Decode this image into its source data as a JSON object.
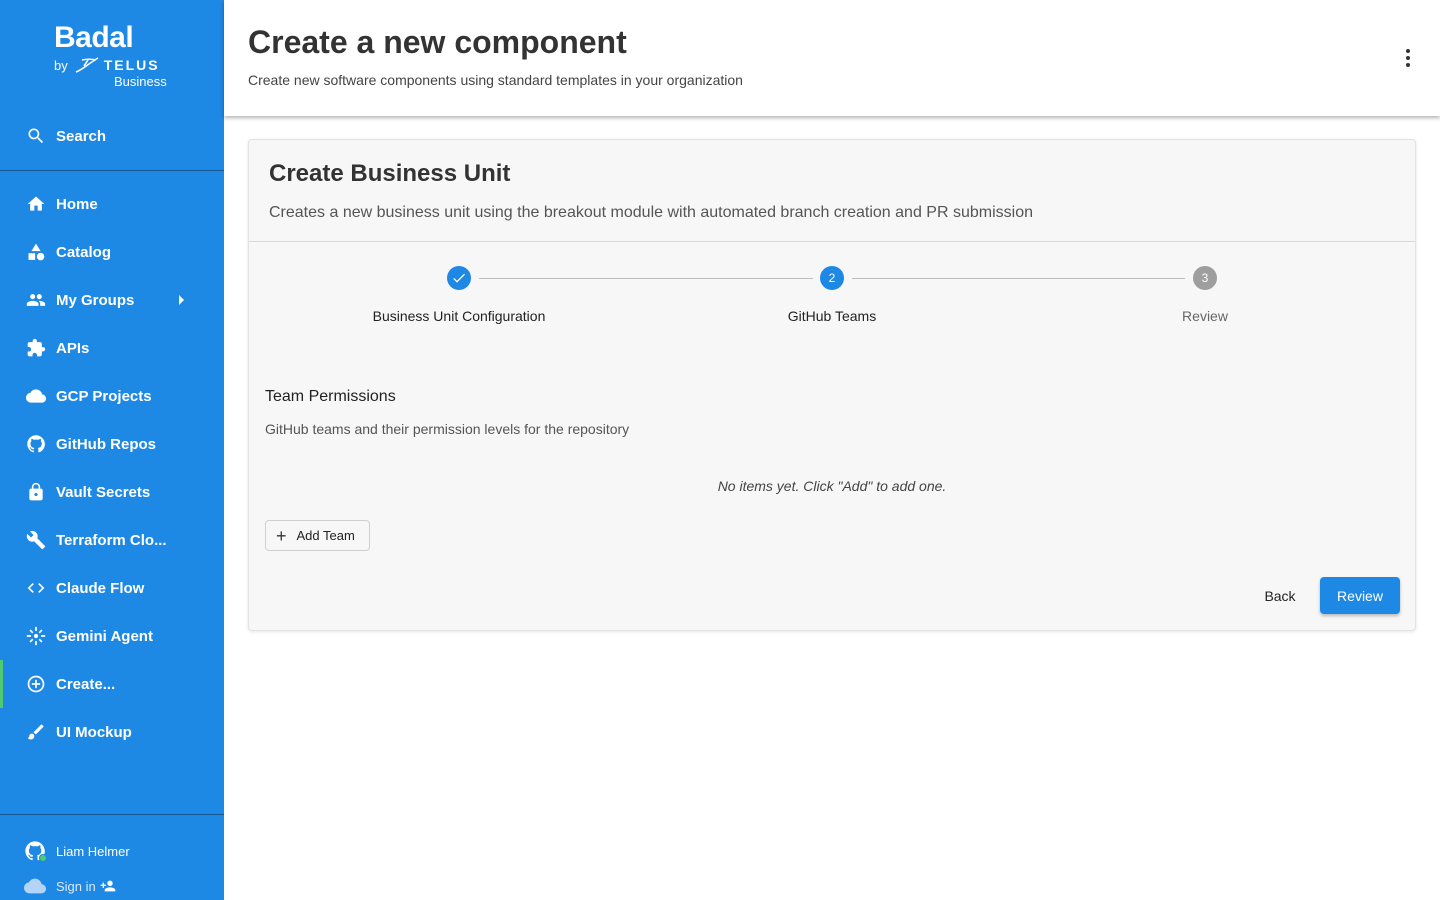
{
  "sidebar": {
    "logo": {
      "brand": "Badal",
      "by": "by",
      "telus": "TELUS",
      "business": "Business"
    },
    "search_label": "Search",
    "items": [
      {
        "label": "Home",
        "icon": "home-icon"
      },
      {
        "label": "Catalog",
        "icon": "category-icon"
      },
      {
        "label": "My Groups",
        "icon": "group-icon"
      },
      {
        "label": "APIs",
        "icon": "extension-icon"
      },
      {
        "label": "GCP Projects",
        "icon": "cloud-icon"
      },
      {
        "label": "GitHub Repos",
        "icon": "github-icon"
      },
      {
        "label": "Vault Secrets",
        "icon": "lock-icon"
      },
      {
        "label": "Terraform Clo...",
        "icon": "wrench-icon"
      },
      {
        "label": "Claude Flow",
        "icon": "code-icon"
      },
      {
        "label": "Gemini Agent",
        "icon": "sparkle-icon"
      },
      {
        "label": "Create...",
        "icon": "add-circle-icon"
      },
      {
        "label": "UI Mockup",
        "icon": "brush-icon"
      }
    ],
    "user_name": "Liam Helmer",
    "sign_in_label": "Sign in",
    "colors": {
      "background": "#1e88e5",
      "active_indicator": "#4ecb71"
    }
  },
  "header": {
    "title": "Create a new component",
    "subtitle": "Create new software components using standard templates in your organization"
  },
  "card": {
    "title": "Create Business Unit",
    "description": "Creates a new business unit using the breakout module with automated branch creation and PR submission",
    "steps": [
      {
        "label": "Business Unit Configuration",
        "state": "done",
        "number": "1"
      },
      {
        "label": "GitHub Teams",
        "state": "active",
        "number": "2"
      },
      {
        "label": "Review",
        "state": "pending",
        "number": "3"
      }
    ],
    "section_title": "Team Permissions",
    "section_description": "GitHub teams and their permission levels for the repository",
    "empty_message": "No items yet. Click \"Add\" to add one.",
    "add_button_label": "Add Team",
    "back_button_label": "Back",
    "review_button_label": "Review"
  }
}
